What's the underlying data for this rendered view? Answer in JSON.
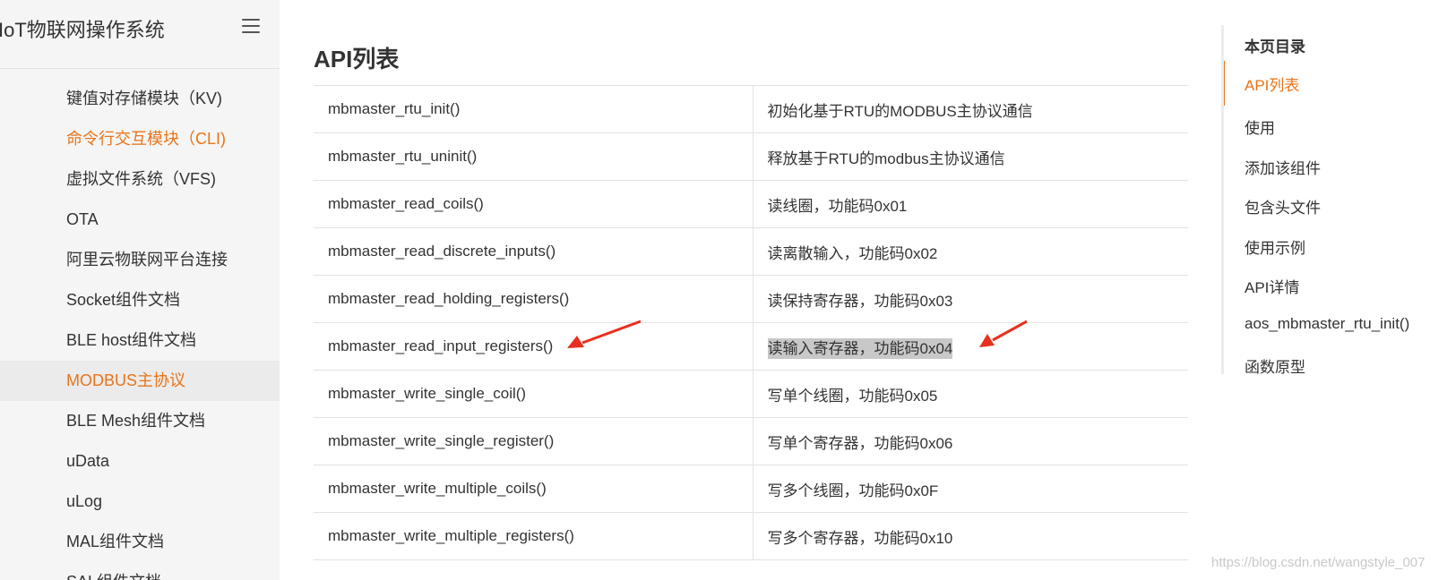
{
  "sidebar": {
    "title": "IoT物联网操作系统",
    "items": [
      {
        "label": "键值对存储模块（KV)"
      },
      {
        "label": "命令行交互模块（CLI)"
      },
      {
        "label": "虚拟文件系统（VFS)"
      },
      {
        "label": "OTA"
      },
      {
        "label": "阿里云物联网平台连接"
      },
      {
        "label": "Socket组件文档"
      },
      {
        "label": "BLE host组件文档"
      },
      {
        "label": "MODBUS主协议"
      },
      {
        "label": "BLE Mesh组件文档"
      },
      {
        "label": "uData"
      },
      {
        "label": "uLog"
      },
      {
        "label": "MAL组件文档"
      },
      {
        "label": "SAL组件文档"
      }
    ]
  },
  "main": {
    "title": "API列表",
    "rows": [
      {
        "func": "mbmaster_rtu_init()",
        "desc": "初始化基于RTU的MODBUS主协议通信"
      },
      {
        "func": "mbmaster_rtu_uninit()",
        "desc": "释放基于RTU的modbus主协议通信"
      },
      {
        "func": "mbmaster_read_coils()",
        "desc": "读线圈，功能码0x01"
      },
      {
        "func": "mbmaster_read_discrete_inputs()",
        "desc": "读离散输入，功能码0x02"
      },
      {
        "func": "mbmaster_read_holding_registers()",
        "desc": "读保持寄存器，功能码0x03"
      },
      {
        "func": "mbmaster_read_input_registers()",
        "desc": "读输入寄存器，功能码0x04"
      },
      {
        "func": "mbmaster_write_single_coil()",
        "desc": "写单个线圈，功能码0x05"
      },
      {
        "func": "mbmaster_write_single_register()",
        "desc": "写单个寄存器，功能码0x06"
      },
      {
        "func": "mbmaster_write_multiple_coils()",
        "desc": "写多个线圈，功能码0x0F"
      },
      {
        "func": "mbmaster_write_multiple_registers()",
        "desc": "写多个寄存器，功能码0x10"
      }
    ]
  },
  "toc": {
    "title": "本页目录",
    "items": [
      {
        "label": "API列表"
      },
      {
        "label": "使用"
      },
      {
        "label": "添加该组件"
      },
      {
        "label": "包含头文件"
      },
      {
        "label": "使用示例"
      },
      {
        "label": "API详情"
      },
      {
        "label": "aos_mbmaster_rtu_init()"
      },
      {
        "label": "函数原型"
      }
    ]
  },
  "watermark": "https://blog.csdn.net/wangstyle_007",
  "colors": {
    "accent": "#e8741a",
    "annotation_arrow": "#e8301e"
  }
}
